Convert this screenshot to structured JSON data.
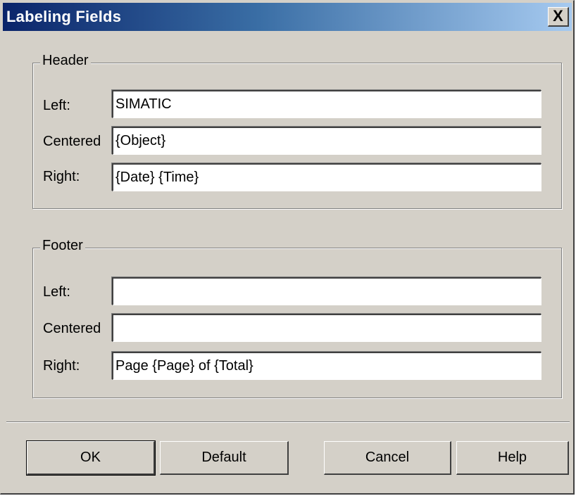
{
  "window": {
    "title": "Labeling Fields",
    "close_label": "X"
  },
  "header_group": {
    "title": "Header",
    "left_label": "Left:",
    "left_value": "SIMATIC",
    "centered_label": "Centered",
    "centered_value": "{Object}",
    "right_label": "Right:",
    "right_value": "{Date} {Time}"
  },
  "footer_group": {
    "title": "Footer",
    "left_label": "Left:",
    "left_value": "",
    "centered_label": "Centered",
    "centered_value": "",
    "right_label": "Right:",
    "right_value": "Page {Page} of {Total}"
  },
  "buttons": {
    "ok": "OK",
    "default": "Default",
    "cancel": "Cancel",
    "help": "Help"
  }
}
